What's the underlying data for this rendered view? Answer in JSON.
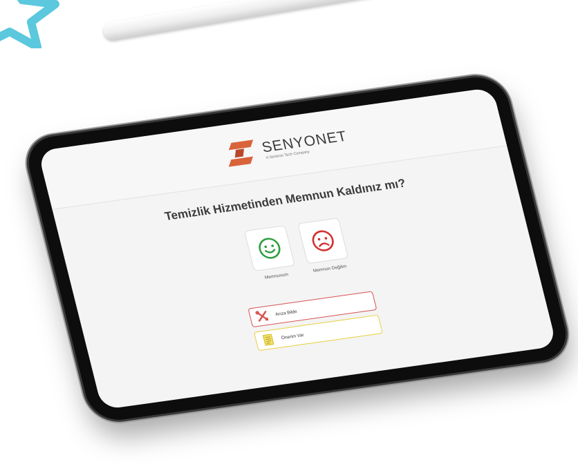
{
  "brand": {
    "name": "SENYONET",
    "tagline": "A Senkron Tech Company"
  },
  "survey": {
    "question": "Temizlik Hizmetinden Memnun Kaldınız mı?",
    "choices": [
      {
        "label": "Memnunum",
        "icon": "smiley-face-icon",
        "color": "#2e9e3f"
      },
      {
        "label": "Memnun Değilim",
        "icon": "sad-face-icon",
        "color": "#d32f2f"
      }
    ],
    "actions": [
      {
        "label": "Arıza Bildir",
        "icon": "wrench-screwdriver-icon",
        "color": "#d94f4f"
      },
      {
        "label": "Önerim Var",
        "icon": "note-icon",
        "color": "#e6cf3c"
      }
    ]
  },
  "colors": {
    "accent": "#d9633b",
    "star": "#5bc8de"
  }
}
